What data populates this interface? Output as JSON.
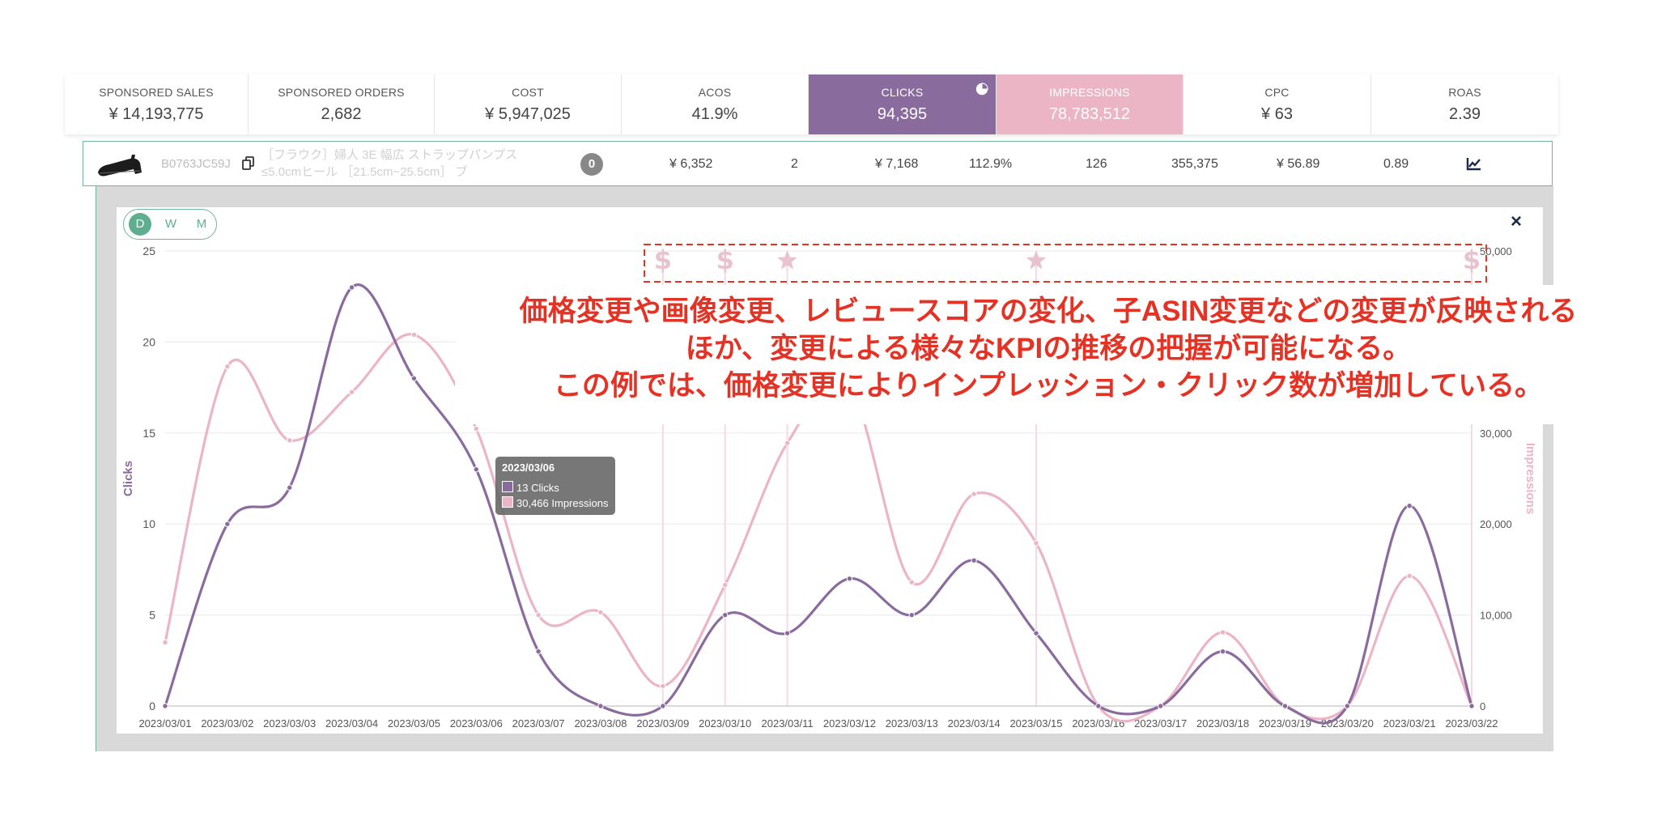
{
  "metrics": [
    {
      "label": "SPONSORED SALES",
      "value": "¥ 14,193,775"
    },
    {
      "label": "SPONSORED ORDERS",
      "value": "2,682"
    },
    {
      "label": "COST",
      "value": "¥ 5,947,025"
    },
    {
      "label": "ACOS",
      "value": "41.9%"
    },
    {
      "label": "CLICKS",
      "value": "94,395"
    },
    {
      "label": "IMPRESSIONS",
      "value": "78,783,512"
    },
    {
      "label": "CPC",
      "value": "¥ 63"
    },
    {
      "label": "ROAS",
      "value": "2.39"
    }
  ],
  "product": {
    "asin": "B0763JC59J",
    "name": "［フラウク］婦人 3E 幅広 ストラップパンプス ≤5.0cmヒール ［21.5cm~25.5cm］ ブ",
    "badge": "0",
    "cells": [
      "¥ 6,352",
      "2",
      "¥ 7,168",
      "112.9%",
      "126",
      "355,375",
      "¥ 56.89",
      "0.89"
    ]
  },
  "toggle": {
    "d": "D",
    "w": "W",
    "m": "M",
    "active": "D"
  },
  "close_label": "×",
  "annotation": [
    "価格変更や画像変更、レビュースコアの変化、子ASIN変更などの変更が反映される",
    "ほか、変更による様々なKPIの推移の把握が可能になる。",
    "この例では、価格変更によりインプレッション・クリック数が増加している。"
  ],
  "tooltip": {
    "title": "2023/03/06",
    "clicks": "13 Clicks",
    "impressions": "30,466 Impressions"
  },
  "colors": {
    "clicks": "#8a6b9e",
    "impressions": "#ecb5c5",
    "accent": "#5fae8f",
    "annotation": "#e43225"
  },
  "chart_data": {
    "type": "line",
    "x": [
      "2023/03/01",
      "2023/03/02",
      "2023/03/03",
      "2023/03/04",
      "2023/03/05",
      "2023/03/06",
      "2023/03/07",
      "2023/03/08",
      "2023/03/09",
      "2023/03/10",
      "2023/03/11",
      "2023/03/12",
      "2023/03/13",
      "2023/03/14",
      "2023/03/15",
      "2023/03/16",
      "2023/03/17",
      "2023/03/18",
      "2023/03/19",
      "2023/03/20",
      "2023/03/21",
      "2023/03/22"
    ],
    "series": [
      {
        "name": "Clicks",
        "axis": "left",
        "color": "#8a6b9e",
        "values": [
          0,
          10,
          12,
          23,
          18,
          13,
          3,
          0,
          0,
          5,
          4,
          7,
          5,
          8,
          4,
          0,
          0,
          3,
          0,
          0,
          11,
          0
        ]
      },
      {
        "name": "Impressions",
        "axis": "right",
        "color": "#ecb5c5",
        "values": [
          7000,
          37300,
          29200,
          34500,
          40800,
          30466,
          10000,
          10300,
          2200,
          13300,
          28900,
          35000,
          13600,
          23300,
          17900,
          0,
          0,
          8100,
          0,
          0,
          14300,
          0
        ]
      }
    ],
    "ylabel": "Clicks",
    "y2label": "Impressions",
    "ylim": [
      0,
      25
    ],
    "y2lim": [
      0,
      50000
    ],
    "yticks": [
      "0",
      "5",
      "10",
      "15",
      "20",
      "25"
    ],
    "y2ticks": [
      "0",
      "10,000",
      "20,000",
      "30,000",
      "40,000",
      "50,000"
    ],
    "grid": true,
    "events": [
      {
        "date": "2023/03/09",
        "icon": "dollar-icon"
      },
      {
        "date": "2023/03/10",
        "icon": "dollar-icon"
      },
      {
        "date": "2023/03/11",
        "icon": "star-icon"
      },
      {
        "date": "2023/03/15",
        "icon": "star-icon"
      },
      {
        "date": "2023/03/22",
        "icon": "dollar-icon"
      }
    ],
    "tooltip_index": 5
  }
}
